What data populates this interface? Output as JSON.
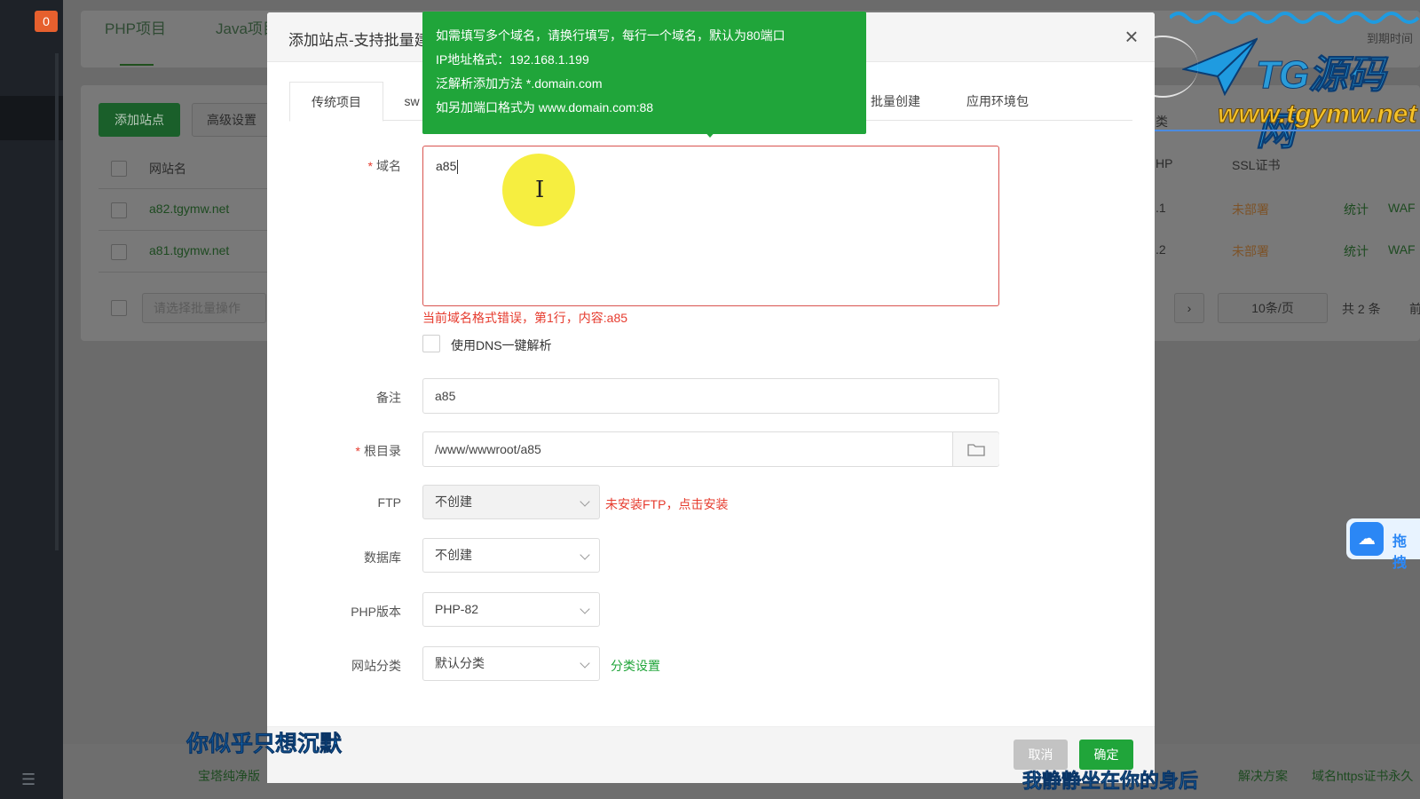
{
  "sidebar": {
    "badge": "0"
  },
  "background": {
    "tabs": [
      "PHP项目",
      "Java项目"
    ],
    "add_site_button": "添加站点",
    "advanced_button": "高级设置",
    "col_site_name": "网站名",
    "col_php": "HP",
    "col_ssl": "SSL证书",
    "rows": [
      {
        "name": "a82.tgymw.net",
        "php": ".1",
        "ssl": "未部署",
        "stats": "统计",
        "waf": "WAF"
      },
      {
        "name": "a81.tgymw.net",
        "php": ".2",
        "ssl": "未部署",
        "stats": "统计",
        "waf": "WAF"
      }
    ],
    "batch_placeholder": "请选择批量操作",
    "page_size": "10条/页",
    "total": "共 2 条",
    "next_page": "前",
    "category_label": "类",
    "footer_left": "宝塔纯净版",
    "footer_mid": "解决方案",
    "footer_right": "域名https证书永久"
  },
  "watermark": {
    "title": "TG源码网",
    "url": "www.tgymw.net",
    "expire": "到期时间"
  },
  "cloud_button": {
    "label": "拖拽"
  },
  "modal": {
    "title": "添加站点-支持批量建站",
    "close": "×",
    "tabs": [
      "传统项目",
      "sw",
      "批量创建",
      "应用环境包"
    ],
    "tooltip": [
      "如需填写多个域名，请换行填写，每行一个域名，默认为80端口",
      "IP地址格式：192.168.1.199",
      "泛解析添加方法 *.domain.com",
      "如另加端口格式为 www.domain.com:88"
    ],
    "domain": {
      "label": "域名",
      "value": "a85",
      "error": "当前域名格式错误，第1行，内容:a85"
    },
    "dns": {
      "label": "使用DNS一键解析"
    },
    "remark": {
      "label": "备注",
      "value": "a85"
    },
    "root": {
      "label": "根目录",
      "value": "/www/wwwroot/a85"
    },
    "ftp": {
      "label": "FTP",
      "value": "不创建",
      "tip": "未安装FTP，点击安装"
    },
    "database": {
      "label": "数据库",
      "value": "不创建"
    },
    "php": {
      "label": "PHP版本",
      "value": "PHP-82"
    },
    "category": {
      "label": "网站分类",
      "value": "默认分类",
      "tip": "分类设置"
    },
    "cancel": "取消",
    "ok": "确定"
  },
  "subtitles": {
    "line1": "你似乎只想沉默",
    "line2": "我静静坐在你的身后"
  },
  "colors": {
    "accent": "#20a53a",
    "error": "#e63b2e",
    "overlay": "#6b6b6b"
  }
}
